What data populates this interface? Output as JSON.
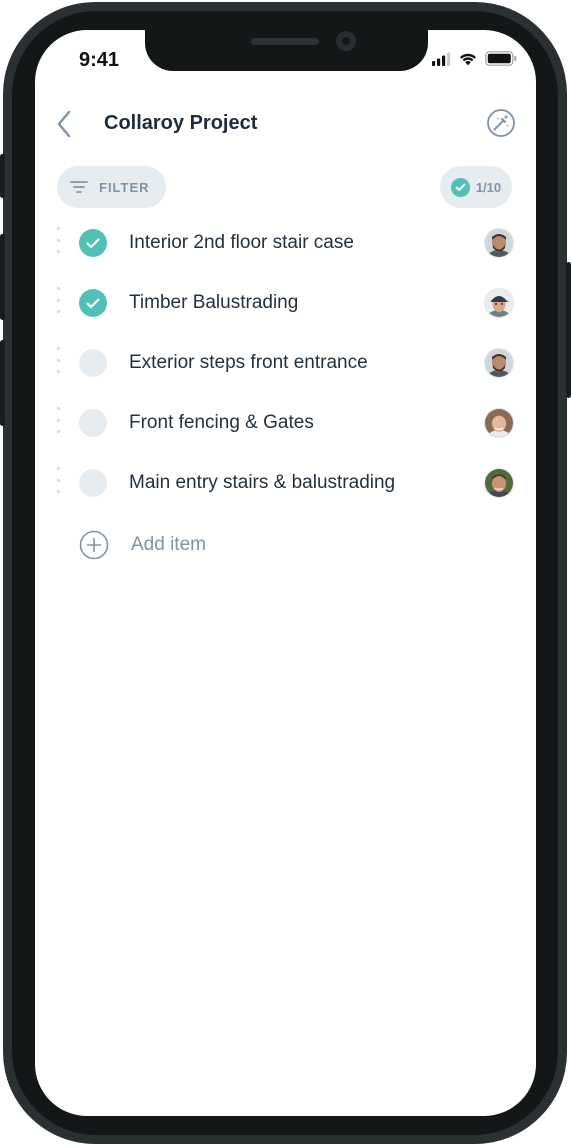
{
  "status_bar": {
    "time": "9:41",
    "signal_icon": "cellular-signal-icon",
    "wifi_icon": "wifi-icon",
    "battery_icon": "battery-icon"
  },
  "header": {
    "title": "Collaroy Project",
    "back_icon": "chevron-left-icon",
    "magic_icon": "magic-wand-icon"
  },
  "toolbar": {
    "filter_label": "FILTER",
    "filter_icon": "filter-lines-icon",
    "progress_text": "1/10",
    "progress_icon": "check-circle-icon"
  },
  "tasks": [
    {
      "label": "Interior 2nd floor stair case",
      "done": true,
      "avatar": "avatar-man-beard-dark"
    },
    {
      "label": "Timber Balustrading",
      "done": true,
      "avatar": "avatar-man-cap"
    },
    {
      "label": "Exterior steps front entrance",
      "done": false,
      "avatar": "avatar-man-beard-dark"
    },
    {
      "label": "Front fencing & Gates",
      "done": false,
      "avatar": "avatar-man-light"
    },
    {
      "label": "Main entry stairs & balustrading",
      "done": false,
      "avatar": "avatar-man-green"
    }
  ],
  "add_item": {
    "label": "Add item",
    "icon": "plus-circle-icon"
  },
  "colors": {
    "accent": "#51c1b8",
    "muted": "#7f93a6",
    "pill_bg": "#e6ebf0",
    "title": "#1f2d3a"
  }
}
